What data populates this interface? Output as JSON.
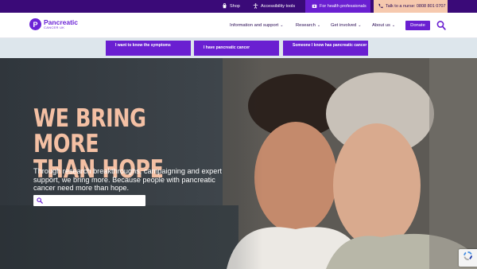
{
  "utility_bar": {
    "shop_label": "Shop",
    "accessibility_label": "Accessibility tools",
    "health_professionals_label": "For health professionals",
    "nurse_label": "Talk to a nurse: 0808 801 0707"
  },
  "logo": {
    "mark": "P",
    "name": "Pancreatic",
    "sub": "CANCER UK"
  },
  "nav": {
    "items": [
      {
        "label": "Information and support"
      },
      {
        "label": "Research"
      },
      {
        "label": "Get involved"
      },
      {
        "label": "About us"
      }
    ],
    "donate_label": "Donate"
  },
  "quick_links": [
    {
      "label": "I want to know the symptoms"
    },
    {
      "label": "I have pancreatic cancer"
    },
    {
      "label": "Someone I know has pancreatic cancer"
    }
  ],
  "hero": {
    "headline_line1": "WE BRING MORE",
    "headline_line2": "THAN HOPE",
    "subtext": "Through research breakthroughs, campaigning and expert support, we bring more. Because people with pancreatic cancer need more than hope.",
    "search_placeholder": ""
  },
  "colors": {
    "topbar": "#3a0a78",
    "brand_purple": "#6a1fd1",
    "nurse_peach": "#f6c9ae",
    "headline_peach": "#f4c0a4",
    "quick_band": "#dde6ec"
  },
  "icons": [
    "shop-icon",
    "accessibility-icon",
    "health-professional-icon",
    "phone-icon",
    "chevron-down-icon",
    "search-icon",
    "recaptcha-icon"
  ]
}
